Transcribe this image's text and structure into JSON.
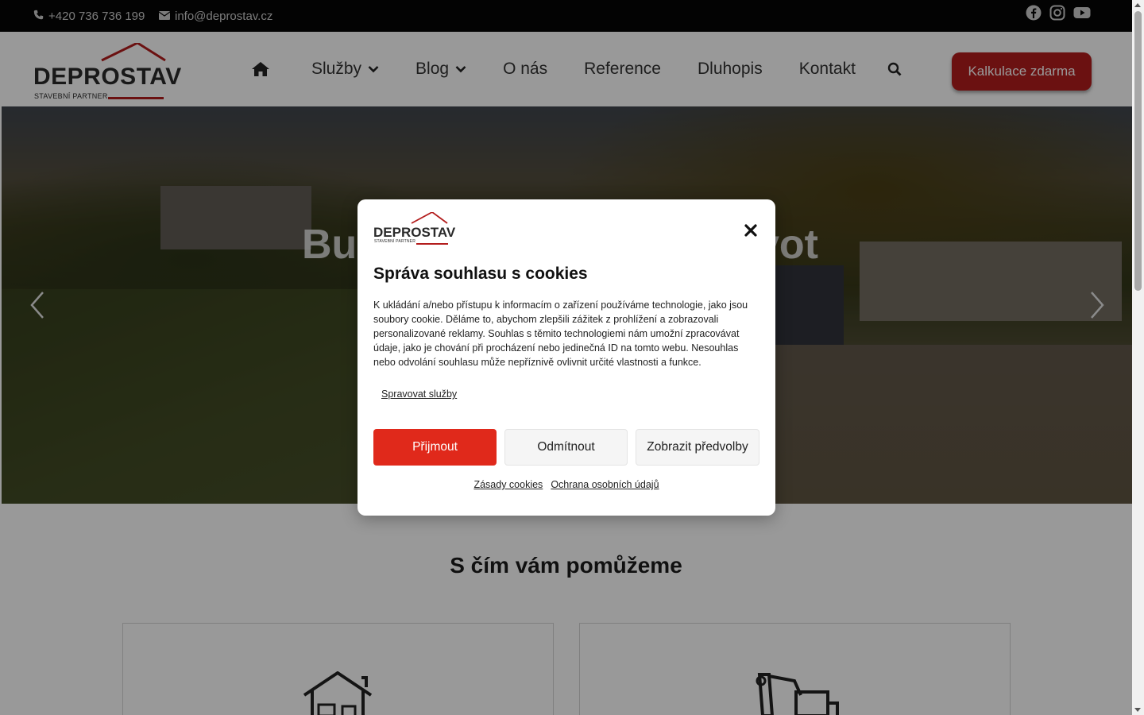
{
  "topbar": {
    "phone": "+420 736 736 199",
    "email": "info@deprostav.cz",
    "social": [
      "facebook-icon",
      "instagram-icon",
      "youtube-icon"
    ]
  },
  "brand": {
    "name": "DEPROSTAV",
    "tagline": "STAVEBNÍ PARTNER",
    "accent": "#b31d1d"
  },
  "nav": {
    "items": [
      {
        "label": "Služby",
        "dropdown": true
      },
      {
        "label": "Blog",
        "dropdown": true
      },
      {
        "label": "O nás"
      },
      {
        "label": "Reference"
      },
      {
        "label": "Dluhopis"
      },
      {
        "label": "Kontakt"
      }
    ],
    "cta": "Kalkulace zdarma"
  },
  "hero": {
    "headline_start": "Bu",
    "headline_end": "vot"
  },
  "section": {
    "title": "S čím vám pomůžeme"
  },
  "cookie_modal": {
    "title": "Správa souhlasu s cookies",
    "body": "K ukládání a/nebo přístupu k informacím o zařízení používáme technologie, jako jsou soubory cookie. Děláme to, abychom zlepšili zážitek z prohlížení a zobrazovali personalizované reklamy. Souhlas s těmito technologiemi nám umožní zpracovávat údaje, jako je chování při procházení nebo jedinečná ID na tomto webu. Nesouhlas nebo odvolání souhlasu může nepříznivě ovlivnit určité vlastnosti a funkce.",
    "manage": "Spravovat služby",
    "accept": "Přijmout",
    "deny": "Odmítnout",
    "preferences": "Zobrazit předvolby",
    "links": [
      "Zásady cookies",
      "Ochrana osobních údajů"
    ],
    "accept_color": "#e0291b"
  }
}
